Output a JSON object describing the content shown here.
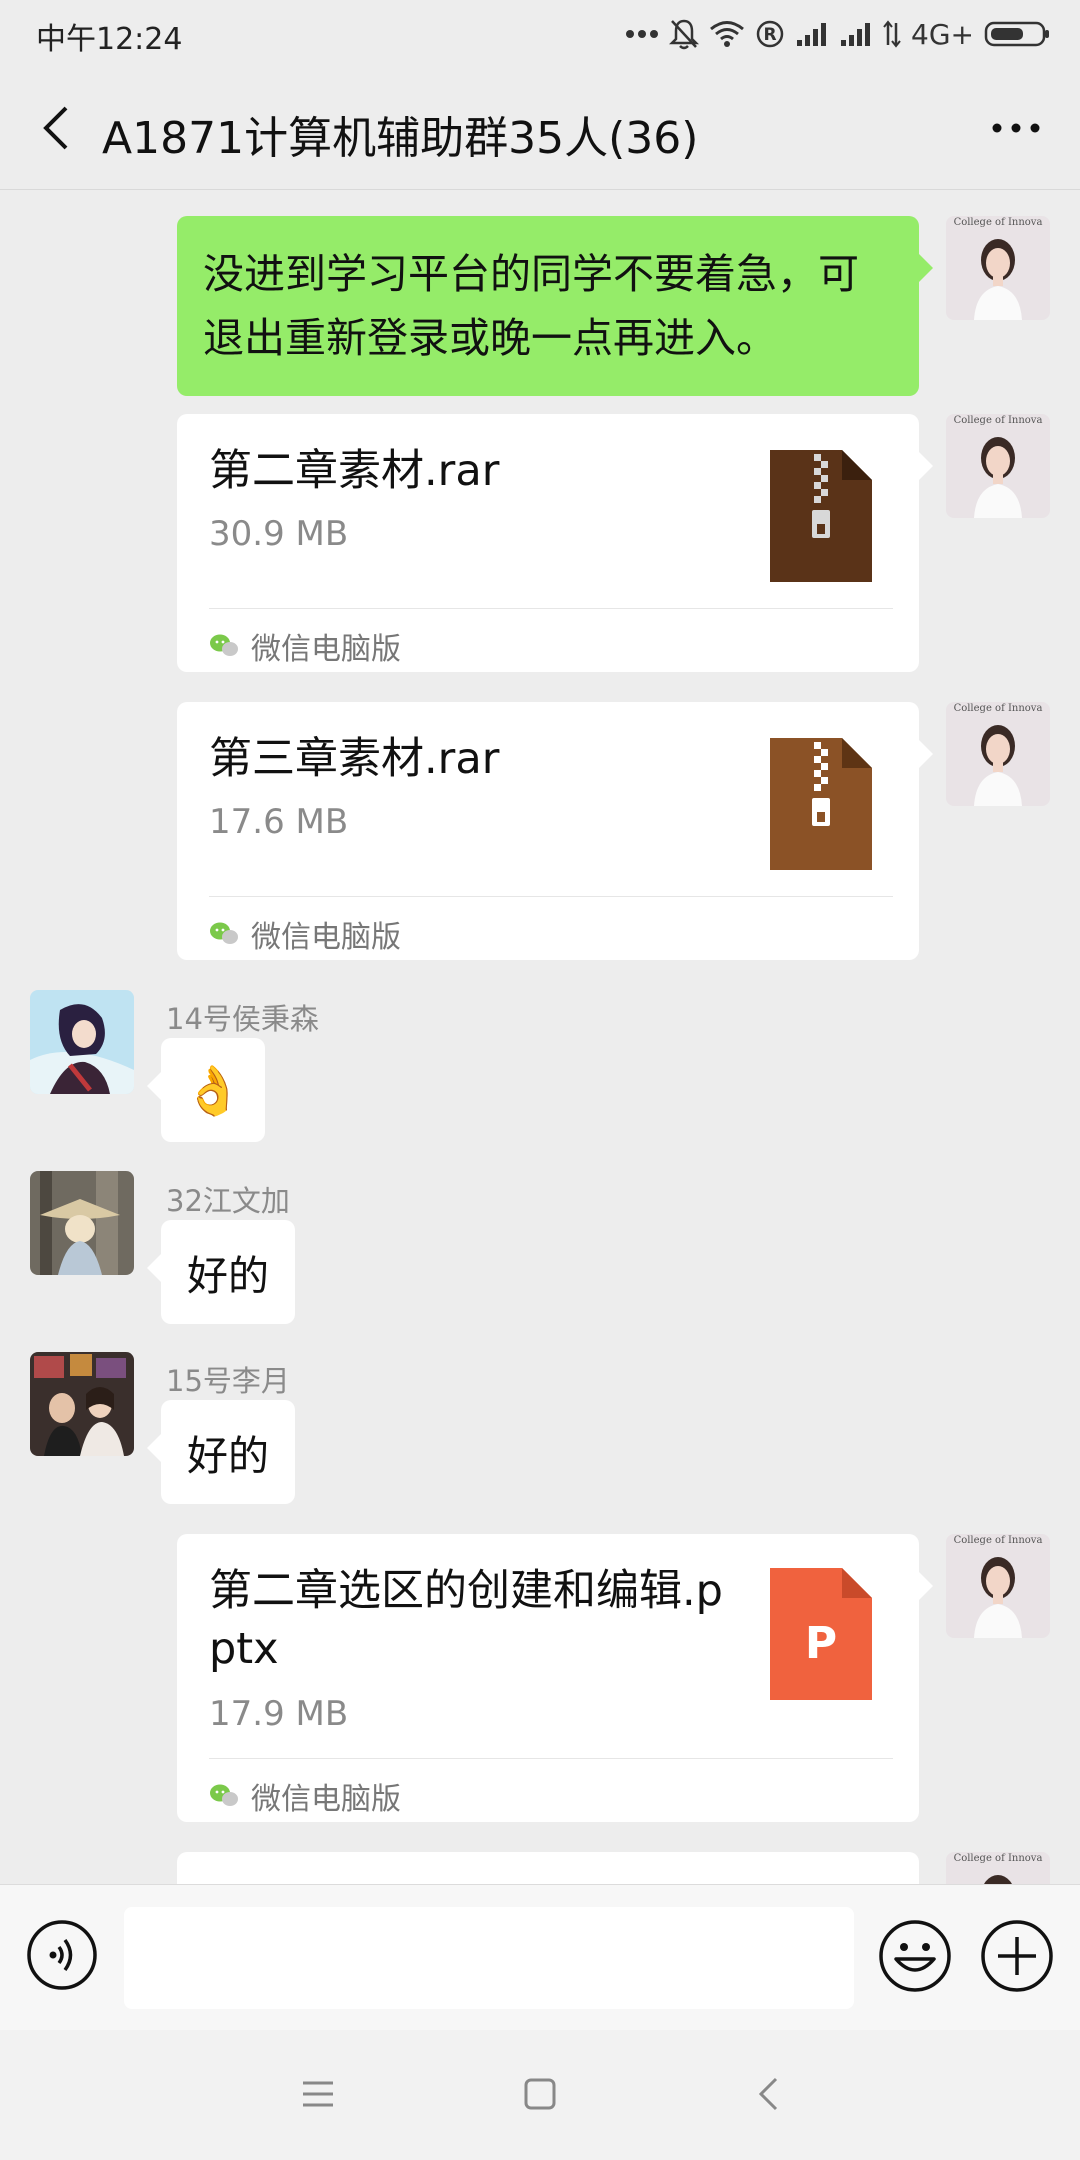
{
  "status_bar": {
    "time": "中午12:24",
    "network": "4G+"
  },
  "header": {
    "title": "A1871计算机辅助群35人(36)"
  },
  "messages": {
    "m1": {
      "text": "没进到学习平台的同学不要着急，可退出重新登录或晚一点再进入。"
    },
    "m2": {
      "file_name": "第二章素材.rar",
      "size": "30.9 MB",
      "source": "微信电脑版",
      "icon": "zip-archive-icon",
      "icon_color": "#5a3318"
    },
    "m3": {
      "file_name": "第三章素材.rar",
      "size": "17.6 MB",
      "source": "微信电脑版",
      "icon": "zip-archive-icon",
      "icon_color": "#8b5226"
    },
    "m4": {
      "sender": "14号侯秉森",
      "emoji": "👌"
    },
    "m5": {
      "sender": "32江文加",
      "text": "好的"
    },
    "m6": {
      "sender": "15号李月",
      "text": "好的"
    },
    "m7": {
      "file_name": "第二章选区的创建和编辑.pptx",
      "size": "17.9 MB",
      "source": "微信电脑版",
      "icon": "powerpoint-file-icon",
      "icon_color": "#f0623e",
      "icon_letter": "P"
    }
  },
  "avatar_caption": "College of Innova",
  "colors": {
    "self_bubble": "#95ec69",
    "background": "#ededed",
    "wechat_green": "#7bc94a"
  }
}
